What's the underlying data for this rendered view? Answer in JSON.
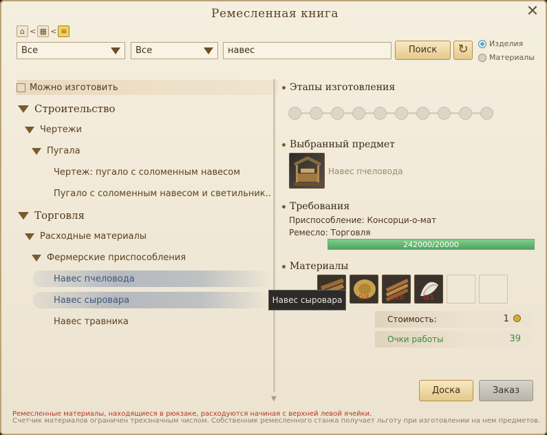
{
  "window": {
    "title": "Ремесленная книга"
  },
  "breadcrumb": {
    "home_icon": "home-icon",
    "grid_icon": "grid-icon",
    "list_icon": "list-icon",
    "sep": "<"
  },
  "filters": {
    "category1": "Все",
    "category2": "Все",
    "search_value": "навес",
    "search_button": "Поиск",
    "radio_items": "Изделия",
    "radio_materials": "Материалы"
  },
  "tree": {
    "craftable_label": "Можно изготовить",
    "construction": "Строительство",
    "blueprints": "Чертежи",
    "scarecrows": "Пугала",
    "blueprint_item": "Чертеж: пугало с соломенным навесом",
    "scarecrow_item": "Пугало с соломенным навесом и светильник..",
    "trade": "Торговля",
    "consumables": "Расходные материалы",
    "farm_devices": "Фермерские приспособления",
    "beekeeper": "Навес пчеловода",
    "cheesemaker": "Навес сыровара",
    "herbalist": "Навес травника"
  },
  "details": {
    "stages_title": "Этапы изготовления",
    "stages_count": 10,
    "selected_title": "Выбранный предмет",
    "selected_name": "Навес пчеловода",
    "requirements_title": "Требования",
    "device_line": "Приспособление: Консорци-о-мат",
    "craft_line": "Ремесло: Торговля",
    "progress_text": "242000/20000",
    "progress_fraction": 1.0,
    "materials_title": "Материалы",
    "materials": [
      {
        "name": "wood-planks-icon",
        "count": ""
      },
      {
        "name": "hay-bale-icon",
        "count": "0/4"
      },
      {
        "name": "lumber-icon",
        "count": "0/20"
      },
      {
        "name": "cloth-icon",
        "count": "0/1"
      },
      {
        "name": "empty-slot",
        "count": ""
      },
      {
        "name": "empty-slot",
        "count": ""
      }
    ],
    "tooltip": "Навес сыровара",
    "cost_label": "Стоимость:",
    "cost_value": "1",
    "work_label": "Очки работы",
    "work_value": "39"
  },
  "buttons": {
    "board": "Доска",
    "order": "Заказ"
  },
  "footer": {
    "line1": "Ремесленные материалы, находящиеся в рюкзаке, расходуются начиная с верхней левой ячейки.",
    "line2": "Счетчик материалов ограничен трехзначным числом. Собственник ремесленного станка получает льготу при изготовлении на нем предметов."
  },
  "colors": {
    "accent": "#7a5a2b",
    "progress": "#5fb36e",
    "highlight": "#3e567a",
    "work_points": "#3f8c3f",
    "warning": "#b03a2a"
  }
}
